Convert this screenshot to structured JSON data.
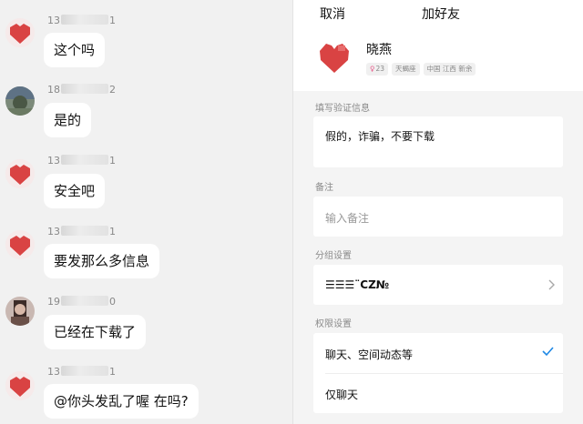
{
  "chat": {
    "messages": [
      {
        "uid_prefix": "13",
        "uid_suffix": "1",
        "text": "这个吗"
      },
      {
        "uid_prefix": "18",
        "uid_suffix": "2",
        "text": "是的"
      },
      {
        "uid_prefix": "13",
        "uid_suffix": "1",
        "text": "安全吧"
      },
      {
        "uid_prefix": "13",
        "uid_suffix": "1",
        "text": "要发那么多信息"
      },
      {
        "uid_prefix": "19",
        "uid_suffix": "0",
        "text": "已经在下载了"
      },
      {
        "uid_prefix": "13",
        "uid_suffix": "1",
        "text": "@你头发乱了喔 在吗?"
      }
    ]
  },
  "add_friend": {
    "cancel_label": "取消",
    "title": "加好友",
    "profile": {
      "name": "晓燕",
      "tags": {
        "age_symbol": "♀",
        "age": "23",
        "zodiac": "天蝎座",
        "location": "中国 江西 新余"
      }
    },
    "verify": {
      "label": "填写验证信息",
      "value": "假的，诈骗，不要下载"
    },
    "remark": {
      "label": "备注",
      "placeholder": "输入备注"
    },
    "group": {
      "label": "分组设置",
      "value": "☰☰☰¨CZ№"
    },
    "permission": {
      "label": "权限设置",
      "options": [
        {
          "label": "聊天、空间动态等",
          "selected": true
        },
        {
          "label": "仅聊天",
          "selected": false
        }
      ]
    },
    "colors": {
      "accent": "#1e88e5",
      "avatar_red": "#d94343"
    }
  }
}
